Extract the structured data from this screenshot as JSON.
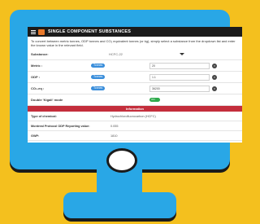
{
  "app": {
    "title": "SINGLE COMPONENT SUBSTANCES"
  },
  "intro": "To convert between metric tonnes, ODP tonnes and CO₂ equivalent tonnes (or kg), simply select a substance from the dropdown list and enter the known value in the relevant field.",
  "substance": {
    "label": "Substance:",
    "value": "HCFC-22"
  },
  "fields": [
    {
      "label": "Metric :",
      "unit": "Tonnes",
      "value": "20"
    },
    {
      "label": "ODP :",
      "unit": "Tonnes",
      "value": "1.1"
    },
    {
      "label": "CO₂-eq :",
      "unit": "Tonnes",
      "value": "36200"
    }
  ],
  "double_kigali": {
    "label": "Double 'Kigali' mode",
    "state": "ON"
  },
  "information": {
    "header": "Information",
    "rows": [
      {
        "key": "Type of chemical:",
        "value": "Hydrochlorofluorocarbon (HCFC)"
      },
      {
        "key": "Montreal Protocol ODP Reporting value:",
        "value": "0.055"
      },
      {
        "key": "GWP:",
        "value": "1810"
      }
    ]
  },
  "colors": {
    "background": "#f4c01e",
    "monitor": "#29a7e6",
    "info_header": "#c42e3c",
    "toggle_on": "#2eaa4b"
  }
}
